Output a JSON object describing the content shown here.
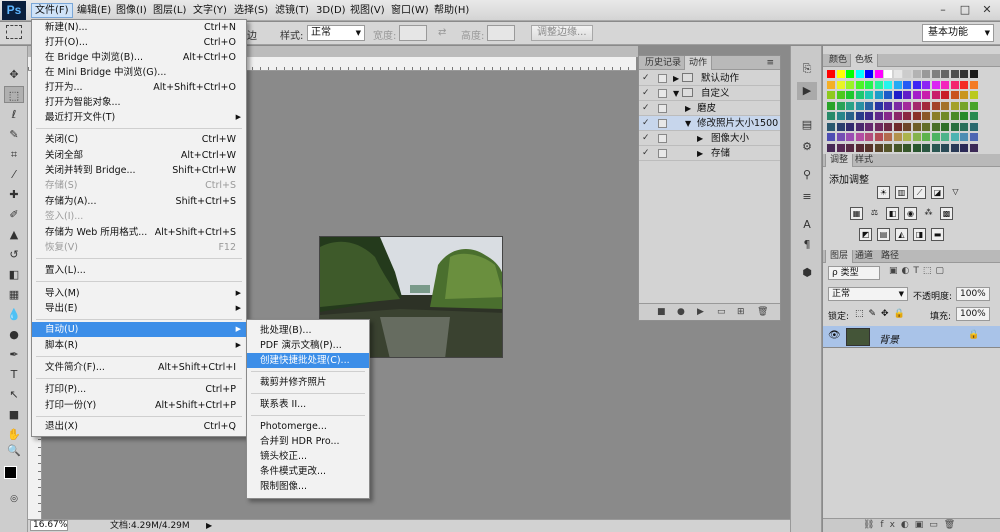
{
  "app_logo": "Ps",
  "menubar": [
    "文件(F)",
    "编辑(E)",
    "图像(I)",
    "图层(L)",
    "文字(Y)",
    "选择(S)",
    "滤镜(T)",
    "3D(D)",
    "视图(V)",
    "窗口(W)",
    "帮助(H)"
  ],
  "window_controls": [
    "–",
    "□",
    "✕"
  ],
  "options": {
    "feather_frag": "边",
    "style_label": "样式:",
    "style_value": "正常",
    "width_label": "宽度:",
    "height_label": "高度:",
    "refine_btn": "调整边缘...",
    "workspace": "基本功能"
  },
  "status": {
    "zoom": "16.67%",
    "doc": "文档:4.29M/4.29M"
  },
  "file_menu": [
    {
      "label": "新建(N)...",
      "shortcut": "Ctrl+N"
    },
    {
      "label": "打开(O)...",
      "shortcut": "Ctrl+O"
    },
    {
      "label": "在 Bridge 中浏览(B)...",
      "shortcut": "Alt+Ctrl+O"
    },
    {
      "label": "在 Mini Bridge 中浏览(G)...",
      "shortcut": ""
    },
    {
      "label": "打开为...",
      "shortcut": "Alt+Shift+Ctrl+O"
    },
    {
      "label": "打开为智能对象...",
      "shortcut": ""
    },
    {
      "label": "最近打开文件(T)",
      "shortcut": ""
    },
    {
      "label": "关闭(C)",
      "shortcut": "Ctrl+W"
    },
    {
      "label": "关闭全部",
      "shortcut": "Alt+Ctrl+W"
    },
    {
      "label": "关闭并转到 Bridge...",
      "shortcut": "Shift+Ctrl+W"
    },
    {
      "label": "存储(S)",
      "shortcut": "Ctrl+S"
    },
    {
      "label": "存储为(A)...",
      "shortcut": "Shift+Ctrl+S"
    },
    {
      "label": "签入(I)...",
      "shortcut": ""
    },
    {
      "label": "存储为 Web 所用格式...",
      "shortcut": "Alt+Shift+Ctrl+S"
    },
    {
      "label": "恢复(V)",
      "shortcut": "F12"
    },
    {
      "label": "置入(L)...",
      "shortcut": ""
    },
    {
      "label": "导入(M)",
      "shortcut": ""
    },
    {
      "label": "导出(E)",
      "shortcut": ""
    },
    {
      "label": "自动(U)",
      "shortcut": ""
    },
    {
      "label": "脚本(R)",
      "shortcut": ""
    },
    {
      "label": "文件简介(F)...",
      "shortcut": "Alt+Shift+Ctrl+I"
    },
    {
      "label": "打印(P)...",
      "shortcut": "Ctrl+P"
    },
    {
      "label": "打印一份(Y)",
      "shortcut": "Alt+Shift+Ctrl+P"
    },
    {
      "label": "退出(X)",
      "shortcut": "Ctrl+Q"
    }
  ],
  "auto_submenu": [
    "批处理(B)...",
    "PDF 演示文稿(P)...",
    "创建快捷批处理(C)...",
    "裁剪并修齐照片",
    "联系表 II...",
    "Photomerge...",
    "合并到 HDR Pro...",
    "镜头校正...",
    "条件模式更改...",
    "限制图像..."
  ],
  "actions_panel": {
    "tabs": [
      "历史记录",
      "动作"
    ],
    "rows": [
      "默认动作",
      "自定义",
      "磨皮",
      "修改照片大小1500",
      "图像大小",
      "存储"
    ]
  },
  "swatches_tabs": [
    "颜色",
    "色板"
  ],
  "adjust_tabs": [
    "调整",
    "样式"
  ],
  "adjust_title": "添加调整",
  "layers_tabs": [
    "图层",
    "通道",
    "路径"
  ],
  "layers": {
    "kind": "ρ 类型",
    "blend": "正常",
    "opacity_label": "不透明度:",
    "opacity": "100%",
    "lock_label": "锁定:",
    "fill_label": "填充:",
    "fill": "100%",
    "layer_name": "背景"
  },
  "colors": {
    "menu_highlight": "#3c8ee8",
    "selected_row": "#c7d6ec",
    "layer_sel": "#a9c3e8"
  }
}
